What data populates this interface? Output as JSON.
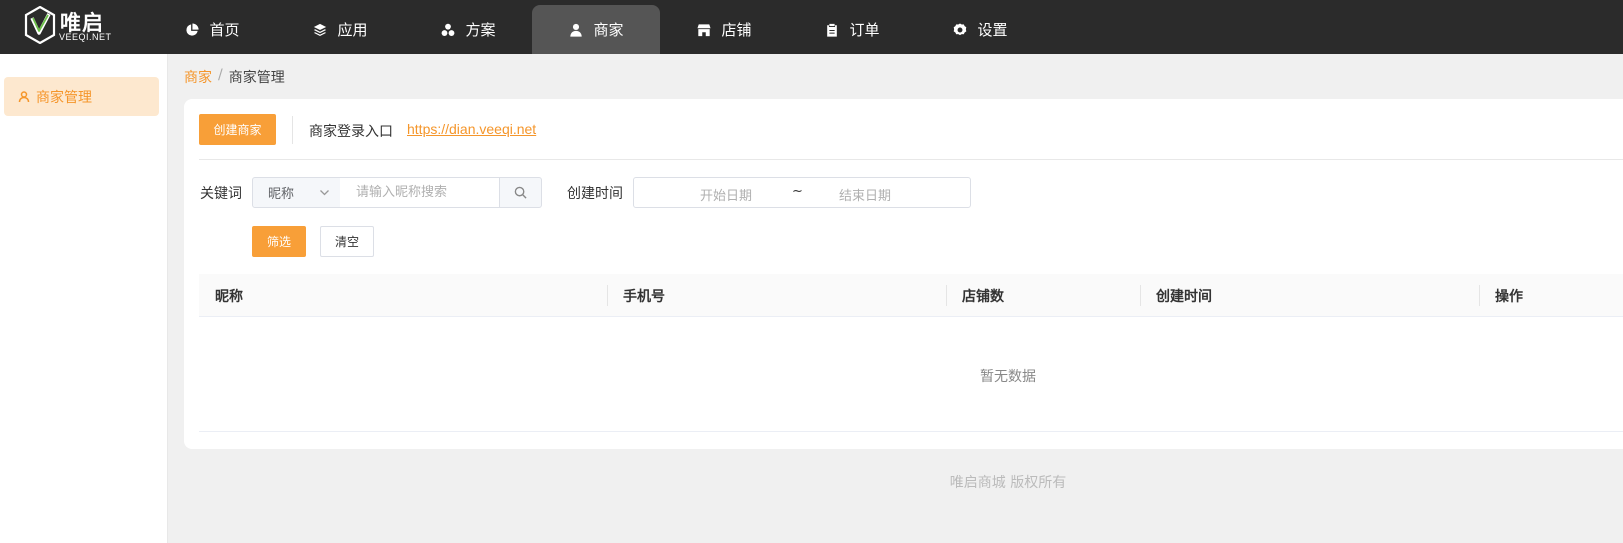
{
  "header": {
    "logo": {
      "brand": "唯启",
      "sub": "VEEQI.NET"
    },
    "nav": [
      {
        "label": "首页",
        "icon": "pie-chart-icon",
        "active": false
      },
      {
        "label": "应用",
        "icon": "layers-icon",
        "active": false
      },
      {
        "label": "方案",
        "icon": "circles-icon",
        "active": false
      },
      {
        "label": "商家",
        "icon": "user-icon",
        "active": true
      },
      {
        "label": "店铺",
        "icon": "store-icon",
        "active": false
      },
      {
        "label": "订单",
        "icon": "clipboard-icon",
        "active": false
      },
      {
        "label": "设置",
        "icon": "gear-icon",
        "active": false
      }
    ]
  },
  "sidebar": {
    "items": [
      {
        "label": "商家管理",
        "icon": "user-outline-icon",
        "active": true
      }
    ]
  },
  "breadcrumb": {
    "parent": "商家",
    "separator": "/",
    "current": "商家管理"
  },
  "toolbar": {
    "create_label": "创建商家",
    "login_label": "商家登录入口",
    "login_url": "https://dian.veeqi.net"
  },
  "filters": {
    "keyword_label": "关键词",
    "keyword_type": "昵称",
    "keyword_placeholder": "请输入昵称搜索",
    "created_label": "创建时间",
    "start_placeholder": "开始日期",
    "range_separator": "~",
    "end_placeholder": "结束日期",
    "filter_label": "筛选",
    "clear_label": "清空"
  },
  "table": {
    "columns": [
      "昵称",
      "手机号",
      "店铺数",
      "创建时间",
      "操作"
    ],
    "rows": [],
    "empty_text": "暂无数据"
  },
  "footer": {
    "text": "唯启商城 版权所有"
  },
  "colors": {
    "accent": "#f89f38",
    "topbar": "#2b2b2b",
    "active_tab": "#555555",
    "sidebar_active_bg": "#fde8cf"
  }
}
